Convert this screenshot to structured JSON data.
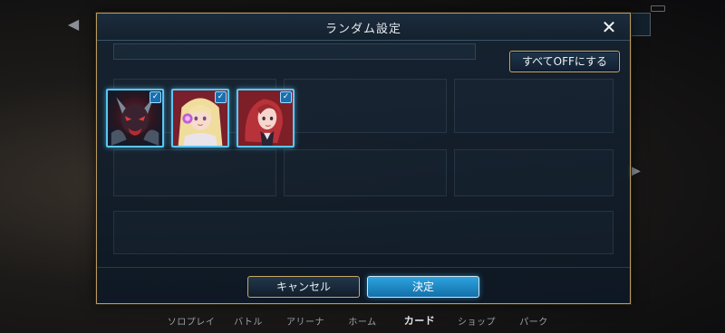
{
  "background": {
    "nav": [
      {
        "label": "ソロプレイ",
        "active": false
      },
      {
        "label": "バトル",
        "active": false
      },
      {
        "label": "アリーナ",
        "active": false
      },
      {
        "label": "ホーム",
        "active": false
      },
      {
        "label": "カード",
        "active": true
      },
      {
        "label": "ショップ",
        "active": false
      },
      {
        "label": "パーク",
        "active": false
      }
    ],
    "back_icon": "chevron-left-icon",
    "next_icon": "chevron-right-icon"
  },
  "dialog": {
    "title": "ランダム設定",
    "close_icon": "close-icon",
    "close_glyph": "✕",
    "all_off_label": "すべてOFFにする",
    "cards": [
      {
        "name": "demon-card",
        "checked": true,
        "check_glyph": "✓"
      },
      {
        "name": "blonde-girl-card",
        "checked": true,
        "check_glyph": "✓"
      },
      {
        "name": "red-hair-woman-card",
        "checked": true,
        "check_glyph": "✓"
      }
    ],
    "cancel_label": "キャンセル",
    "confirm_label": "決定"
  },
  "colors": {
    "frame_gold": "#b99a5e",
    "accent_blue": "#2ca3df",
    "card_border": "#5cc6f2"
  }
}
